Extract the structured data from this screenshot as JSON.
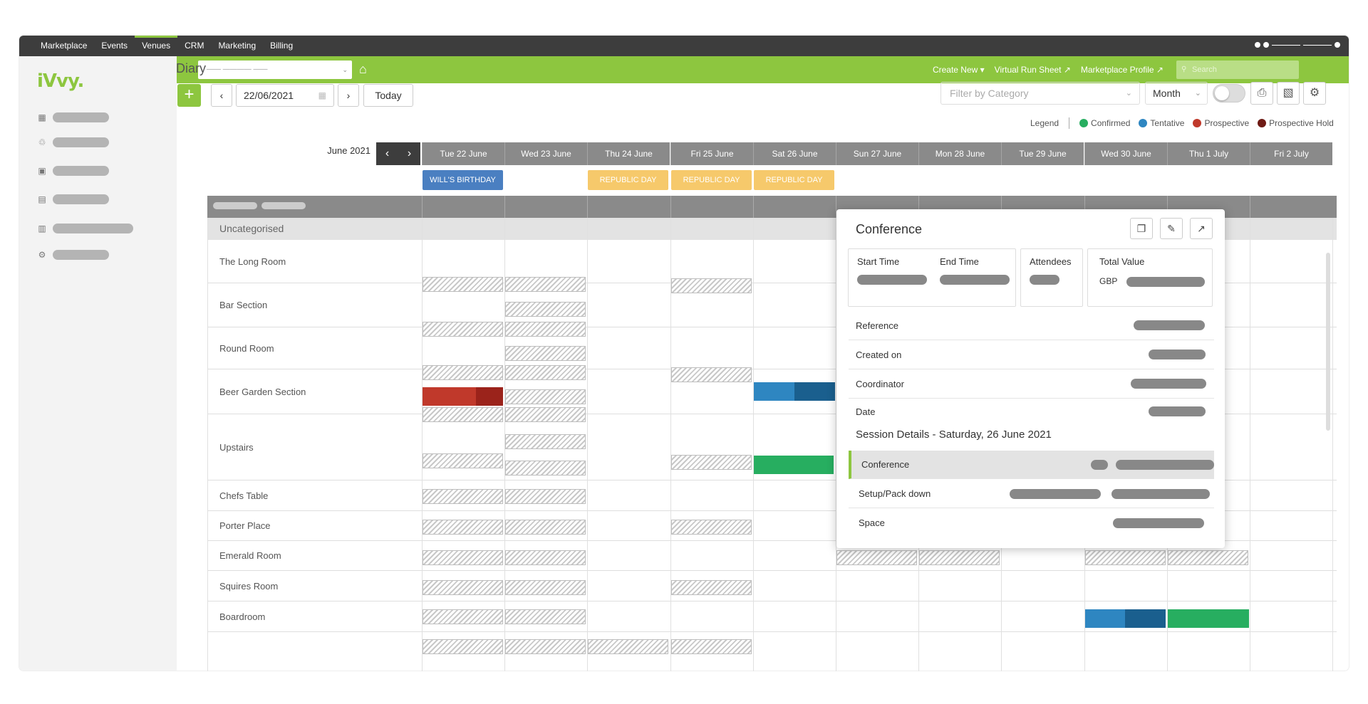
{
  "topnav": {
    "items": [
      "Marketplace",
      "Events",
      "Venues",
      "CRM",
      "Marketing",
      "Billing"
    ],
    "active_index": 2
  },
  "logo": "iVvy.",
  "sidebar": {
    "icons": [
      "calendar-icon",
      "people-icon",
      "briefcase-icon",
      "calculator-icon",
      "bar-chart-icon",
      "cog-icon"
    ]
  },
  "greenbar": {
    "create_new": "Create New ▾",
    "virtual_run_sheet": "Virtual Run Sheet ↗",
    "marketplace_profile": "Marketplace Profile ↗",
    "search_placeholder": "Search"
  },
  "diary": {
    "title": "Diary",
    "add": "+",
    "date_value": "22/06/2021",
    "today": "Today",
    "filter_placeholder": "Filter by Category",
    "view": "Month"
  },
  "legend": {
    "label": "Legend",
    "items": [
      {
        "label": "Confirmed",
        "color": "#27ae60"
      },
      {
        "label": "Tentative",
        "color": "#2e86c1"
      },
      {
        "label": "Prospective",
        "color": "#c0392b"
      },
      {
        "label": "Prospective Hold",
        "color": "#6e1a14"
      }
    ]
  },
  "calendar": {
    "month_label": "June 2021",
    "days": [
      "Tue 22 June",
      "Wed 23 June",
      "Thu 24 June",
      "Fri 25 June",
      "Sat 26 June",
      "Sun 27 June",
      "Mon 28 June",
      "Tue 29 June",
      "Wed 30 June",
      "Thu 1 July",
      "Fri 2 July"
    ],
    "holidays": [
      {
        "label": "WILL'S BIRTHDAY",
        "day": 0,
        "color": "#4a7fc1"
      },
      {
        "label": "REPUBLIC DAY",
        "day": 2,
        "color": "#f6c96b"
      },
      {
        "label": "REPUBLIC DAY",
        "day": 3,
        "color": "#f6c96b"
      },
      {
        "label": "REPUBLIC DAY",
        "day": 4,
        "color": "#f6c96b"
      }
    ],
    "group": "Uncategorised",
    "rooms": [
      "The Long Room",
      "Bar Section",
      "Round Room",
      "Beer Garden Section",
      "Upstairs",
      "Chefs Table",
      "Porter Place",
      "Emerald Room",
      "Squires Room",
      "Boardroom"
    ]
  },
  "popup": {
    "title": "Conference",
    "start_time": "Start Time",
    "end_time": "End Time",
    "attendees": "Attendees",
    "total_value": "Total Value",
    "currency": "GBP",
    "reference": "Reference",
    "created_on": "Created on",
    "coordinator": "Coordinator",
    "date": "Date",
    "session_title": "Session Details - Saturday, 26 June 2021",
    "session_rows": [
      "Conference",
      "Setup/Pack down",
      "Space"
    ]
  }
}
